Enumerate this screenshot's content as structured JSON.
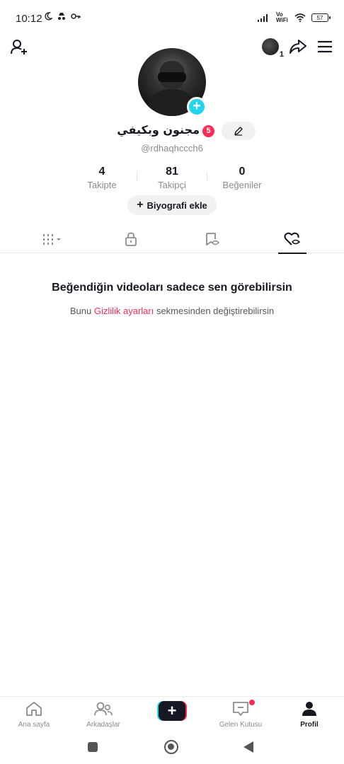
{
  "status_bar": {
    "time": "10:12",
    "network": "Vo WiFi",
    "battery": "57"
  },
  "header": {
    "account_badge": "1"
  },
  "profile": {
    "display_name": "مجنون وبكيفي",
    "name_badge": "5",
    "username": "@rdhaqhccch6"
  },
  "stats": [
    {
      "value": "4",
      "label": "Takipte"
    },
    {
      "value": "81",
      "label": "Takipçi"
    },
    {
      "value": "0",
      "label": "Beğeniler"
    }
  ],
  "bio_button": {
    "plus": "+",
    "label": "Biyografi ekle"
  },
  "empty_state": {
    "title": "Beğendiğin videoları sadece sen görebilirsin",
    "sub_prefix": "Bunu ",
    "sub_link": "Gizlilik ayarları",
    "sub_suffix": " sekmesinden değiştirebilirsin"
  },
  "bottom_nav": [
    {
      "label": "Ana sayfa",
      "icon": "home-icon"
    },
    {
      "label": "Arkadaşlar",
      "icon": "friends-icon"
    },
    {
      "label": "+",
      "icon": "create-icon"
    },
    {
      "label": "Gelen Kutusu",
      "icon": "inbox-icon"
    },
    {
      "label": "Profil",
      "icon": "profile-icon"
    }
  ],
  "colors": {
    "accent": "#fe2c55",
    "cyan": "#20d5ec",
    "text": "#161823",
    "muted": "#8a8b91"
  }
}
